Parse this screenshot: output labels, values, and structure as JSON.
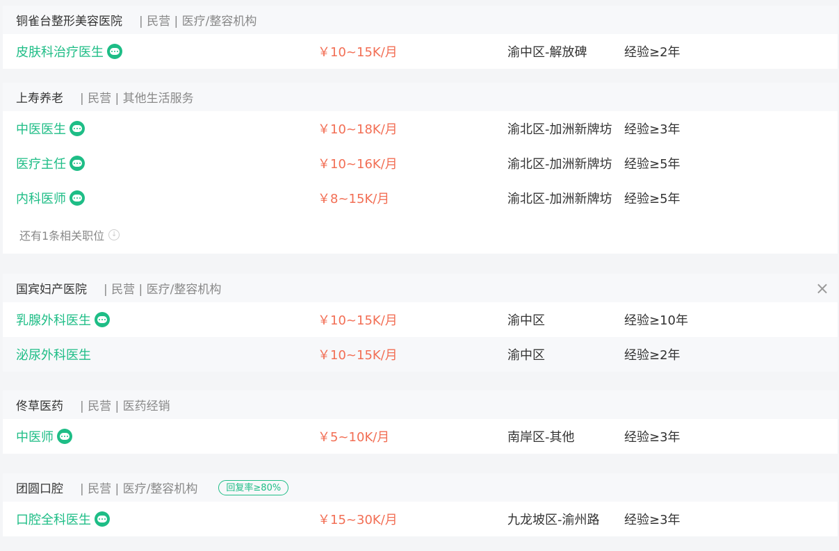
{
  "colors": {
    "accent": "#1ebd86",
    "salary": "#f26e54"
  },
  "companies": [
    {
      "name": "铜雀台整形美容医院",
      "meta": "| 民营 | 医疗/整容机构",
      "jobs": [
        {
          "title": "皮肤科治疗医生",
          "chat": true,
          "salary": "￥10~15K/月",
          "location": "渝中区-解放碑",
          "experience": "经验≥2年"
        }
      ]
    },
    {
      "name": "上寿养老",
      "meta": "| 民营 | 其他生活服务",
      "jobs": [
        {
          "title": "中医医生",
          "chat": true,
          "salary": "￥10~18K/月",
          "location": "渝北区-加洲新牌坊",
          "experience": "经验≥3年"
        },
        {
          "title": "医疗主任",
          "chat": true,
          "salary": "￥10~16K/月",
          "location": "渝北区-加洲新牌坊",
          "experience": "经验≥5年"
        },
        {
          "title": "内科医师",
          "chat": true,
          "salary": "￥8~15K/月",
          "location": "渝北区-加洲新牌坊",
          "experience": "经验≥5年"
        }
      ],
      "more": "还有1条相关职位"
    },
    {
      "name": "国宾妇产医院",
      "meta": "| 民营 | 医疗/整容机构",
      "close": "×",
      "jobs": [
        {
          "title": "乳腺外科医生",
          "chat": true,
          "salary": "￥10~15K/月",
          "location": "渝中区",
          "experience": "经验≥10年"
        },
        {
          "title": "泌尿外科医生",
          "chat": false,
          "salary": "￥10~15K/月",
          "location": "渝中区",
          "experience": "经验≥2年"
        }
      ]
    },
    {
      "name": "佟草医药",
      "meta": "| 民营 | 医药经销",
      "jobs": [
        {
          "title": "中医师",
          "chat": true,
          "salary": "￥5~10K/月",
          "location": "南岸区-其他",
          "experience": "经验≥3年"
        }
      ]
    },
    {
      "name": "团圆口腔",
      "meta": "| 民营 | 医疗/整容机构",
      "badge": "回复率≥80%",
      "jobs": [
        {
          "title": "口腔全科医生",
          "chat": true,
          "salary": "￥15~30K/月",
          "location": "九龙坡区-渝州路",
          "experience": "经验≥3年"
        }
      ]
    }
  ]
}
